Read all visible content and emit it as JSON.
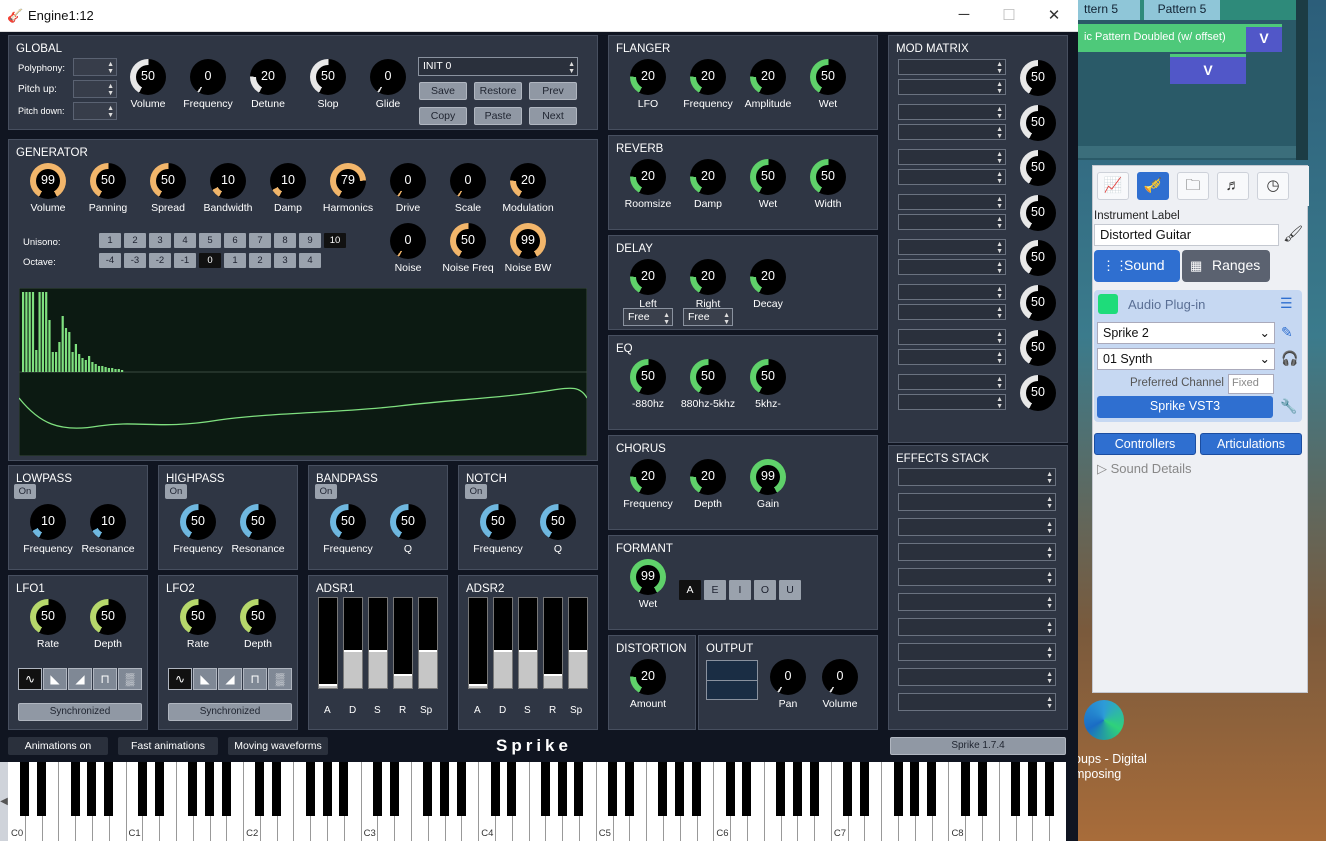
{
  "window": {
    "title": "Engine1:12",
    "min": "─",
    "max": "☐",
    "close": "✕"
  },
  "global": {
    "title": "GLOBAL",
    "polyphony": "Polyphony:",
    "pitch_up": "Pitch up:",
    "pitch_down": "Pitch down:",
    "knobs": [
      {
        "label": "Volume",
        "value": "50"
      },
      {
        "label": "Frequency",
        "value": "0"
      },
      {
        "label": "Detune",
        "value": "20"
      },
      {
        "label": "Slop",
        "value": "50"
      },
      {
        "label": "Glide",
        "value": "0"
      }
    ],
    "preset": "INIT 0",
    "buttons": [
      "Save",
      "Restore",
      "Prev",
      "Copy",
      "Paste",
      "Next"
    ]
  },
  "generator": {
    "title": "GENERATOR",
    "knobs": [
      {
        "label": "Volume",
        "value": "99"
      },
      {
        "label": "Panning",
        "value": "50"
      },
      {
        "label": "Spread",
        "value": "50"
      },
      {
        "label": "Bandwidth",
        "value": "10"
      },
      {
        "label": "Damp",
        "value": "10"
      },
      {
        "label": "Harmonics",
        "value": "79"
      },
      {
        "label": "Drive",
        "value": "0"
      },
      {
        "label": "Scale",
        "value": "0"
      },
      {
        "label": "Modulation",
        "value": "20"
      }
    ],
    "unisono_label": "Unisono:",
    "octave_label": "Octave:",
    "unisono": [
      "1",
      "2",
      "3",
      "4",
      "5",
      "6",
      "7",
      "8",
      "9",
      "10"
    ],
    "octave": [
      "-4",
      "-3",
      "-2",
      "-1",
      "0",
      "1",
      "2",
      "3",
      "4"
    ],
    "noise": [
      {
        "label": "Noise",
        "value": "0"
      },
      {
        "label": "Noise Freq",
        "value": "50"
      },
      {
        "label": "Noise BW",
        "value": "99"
      }
    ]
  },
  "filters": [
    {
      "title": "LOWPASS",
      "on": "On",
      "knobs": [
        {
          "label": "Frequency",
          "value": "10"
        },
        {
          "label": "Resonance",
          "value": "10"
        }
      ]
    },
    {
      "title": "HIGHPASS",
      "on": "On",
      "knobs": [
        {
          "label": "Frequency",
          "value": "50"
        },
        {
          "label": "Resonance",
          "value": "50"
        }
      ]
    },
    {
      "title": "BANDPASS",
      "on": "On",
      "knobs": [
        {
          "label": "Frequency",
          "value": "50"
        },
        {
          "label": "Q",
          "value": "50"
        }
      ]
    },
    {
      "title": "NOTCH",
      "on": "On",
      "knobs": [
        {
          "label": "Frequency",
          "value": "50"
        },
        {
          "label": "Q",
          "value": "50"
        }
      ]
    }
  ],
  "lfos": [
    {
      "title": "LFO1",
      "knobs": [
        {
          "label": "Rate",
          "value": "50"
        },
        {
          "label": "Depth",
          "value": "50"
        }
      ],
      "sync": "Synchronized"
    },
    {
      "title": "LFO2",
      "knobs": [
        {
          "label": "Rate",
          "value": "50"
        },
        {
          "label": "Depth",
          "value": "50"
        }
      ],
      "sync": "Synchronized"
    }
  ],
  "adsr": [
    {
      "title": "ADSR1",
      "labels": [
        "A",
        "D",
        "S",
        "R",
        "Sp"
      ],
      "levels": [
        0.04,
        0.42,
        0.42,
        0.15,
        0.42
      ]
    },
    {
      "title": "ADSR2",
      "labels": [
        "A",
        "D",
        "S",
        "R",
        "Sp"
      ],
      "levels": [
        0.04,
        0.42,
        0.42,
        0.15,
        0.42
      ]
    }
  ],
  "flanger": {
    "title": "FLANGER",
    "knobs": [
      {
        "label": "LFO",
        "value": "20"
      },
      {
        "label": "Frequency",
        "value": "20"
      },
      {
        "label": "Amplitude",
        "value": "20"
      },
      {
        "label": "Wet",
        "value": "50"
      }
    ]
  },
  "reverb": {
    "title": "REVERB",
    "knobs": [
      {
        "label": "Roomsize",
        "value": "20"
      },
      {
        "label": "Damp",
        "value": "20"
      },
      {
        "label": "Wet",
        "value": "50"
      },
      {
        "label": "Width",
        "value": "50"
      }
    ]
  },
  "delay": {
    "title": "DELAY",
    "knobs": [
      {
        "label": "Left",
        "value": "20"
      },
      {
        "label": "Right",
        "value": "20"
      },
      {
        "label": "Decay",
        "value": "20"
      }
    ],
    "left_mode": "Free",
    "right_mode": "Free"
  },
  "eq": {
    "title": "EQ",
    "knobs": [
      {
        "label": "-880hz",
        "value": "50"
      },
      {
        "label": "880hz-5khz",
        "value": "50"
      },
      {
        "label": "5khz-",
        "value": "50"
      }
    ]
  },
  "chorus": {
    "title": "CHORUS",
    "knobs": [
      {
        "label": "Frequency",
        "value": "20"
      },
      {
        "label": "Depth",
        "value": "20"
      },
      {
        "label": "Gain",
        "value": "99"
      }
    ]
  },
  "formant": {
    "title": "FORMANT",
    "knob": {
      "label": "Wet",
      "value": "99"
    },
    "vowels": [
      "A",
      "E",
      "I",
      "O",
      "U"
    ]
  },
  "distortion": {
    "title": "DISTORTION",
    "knob": {
      "label": "Amount",
      "value": "20"
    }
  },
  "output": {
    "title": "OUTPUT",
    "knobs": [
      {
        "label": "Pan",
        "value": "0"
      },
      {
        "label": "Volume",
        "value": "0"
      }
    ]
  },
  "modmatrix": {
    "title": "MOD MATRIX",
    "values": [
      "50",
      "50",
      "50",
      "50",
      "50",
      "50",
      "50",
      "50"
    ]
  },
  "effects": {
    "title": "EFFECTS STACK"
  },
  "footer": {
    "animations": "Animations on",
    "fast": "Fast animations",
    "moving": "Moving waveforms",
    "brand": "Sprike",
    "version": "Sprike 1.7.4"
  },
  "keyboard": {
    "octaves": [
      "C0",
      "C1",
      "C2",
      "C3",
      "C4",
      "C5",
      "C6",
      "C7",
      "C8"
    ]
  },
  "host": {
    "pattern5a": "ttern 5",
    "pattern5b": "Pattern 5",
    "clip": "ic Pattern Doubled  (w/ offset)",
    "v": "V",
    "instrument_label": "Instrument Label",
    "instrument_value": "Distorted Guitar",
    "sound": "Sound",
    "ranges": "Ranges",
    "audio_plugin": "Audio Plug-in",
    "plugin": "Sprike 2",
    "preset": "01 Synth",
    "preferred": "Preferred Channel",
    "fixed": "Fixed",
    "vst": "Sprike VST3",
    "controllers": "Controllers",
    "articulations": "Articulations",
    "details": "Sound Details",
    "desktop": "oups - Digital",
    "desktop2": "mposing"
  },
  "colors": {
    "panel": "#2f3644",
    "accent_green": "#5fd16a",
    "accent_orange": "#f2b66b",
    "accent_blue": "#6fb8e0",
    "accent_olive": "#b6d86b",
    "host_blue": "#2f6fd0"
  }
}
